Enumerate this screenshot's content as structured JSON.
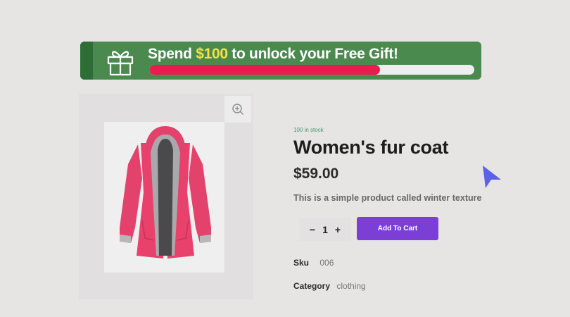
{
  "banner": {
    "text_before": "Spend",
    "amount": "$100",
    "text_after": "to unlock your Free Gift!",
    "progress": 0.71,
    "colors": {
      "background": "#4a8a4f",
      "fill": "#ea1c4f",
      "amount": "#f8e046"
    },
    "icon": "gift-icon"
  },
  "gallery": {
    "zoom_icon": "zoom-in-icon"
  },
  "product": {
    "stock": "100 in stock",
    "title": "Women's fur coat",
    "price": "$59.00",
    "description": "This is a simple product called winter texture",
    "quantity": {
      "minus": "−",
      "value": "1",
      "plus": "+"
    },
    "add_to_cart": "Add To Cart",
    "meta": [
      {
        "label": "Sku",
        "value": "006"
      },
      {
        "label": "Category",
        "value": "clothing"
      }
    ],
    "colors": {
      "button": "#7c3fd6",
      "stock": "#3f9a6a"
    }
  },
  "cursor": {
    "icon": "pointer-cursor-icon",
    "color": "#5b62e6"
  }
}
